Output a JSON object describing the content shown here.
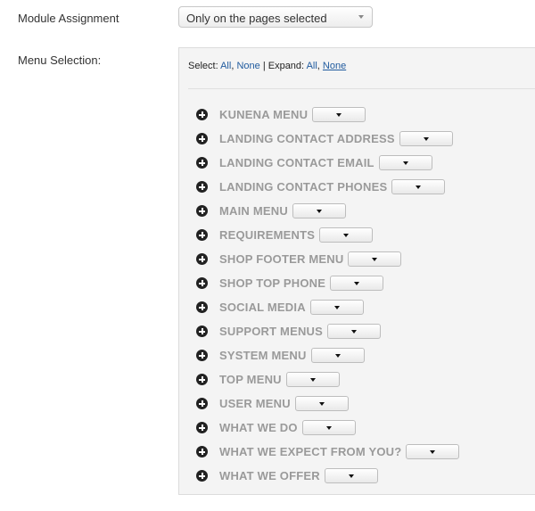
{
  "module_assignment": {
    "label": "Module Assignment",
    "selected": "Only on the pages selected"
  },
  "menu_selection": {
    "label": "Menu Selection:",
    "toolbar": {
      "select_label": "Select:",
      "select_all": "All",
      "select_none": "None",
      "separator": "|",
      "expand_label": "Expand:",
      "expand_all": "All",
      "expand_none": "None"
    },
    "items": [
      {
        "label": "KUNENA MENU"
      },
      {
        "label": "LANDING CONTACT ADDRESS"
      },
      {
        "label": "LANDING CONTACT EMAIL"
      },
      {
        "label": "LANDING CONTACT PHONES"
      },
      {
        "label": "MAIN MENU"
      },
      {
        "label": "REQUIREMENTS"
      },
      {
        "label": "SHOP FOOTER MENU"
      },
      {
        "label": "SHOP TOP PHONE"
      },
      {
        "label": "SOCIAL MEDIA"
      },
      {
        "label": "SUPPORT MENUS"
      },
      {
        "label": "SYSTEM MENU"
      },
      {
        "label": "TOP MENU"
      },
      {
        "label": "USER MENU"
      },
      {
        "label": "WHAT WE DO"
      },
      {
        "label": "WHAT WE EXPECT FROM YOU?"
      },
      {
        "label": "WHAT WE OFFER"
      }
    ],
    "icons": {
      "expand": "plus-circle-icon",
      "dropdown": "caret-down-icon"
    }
  }
}
